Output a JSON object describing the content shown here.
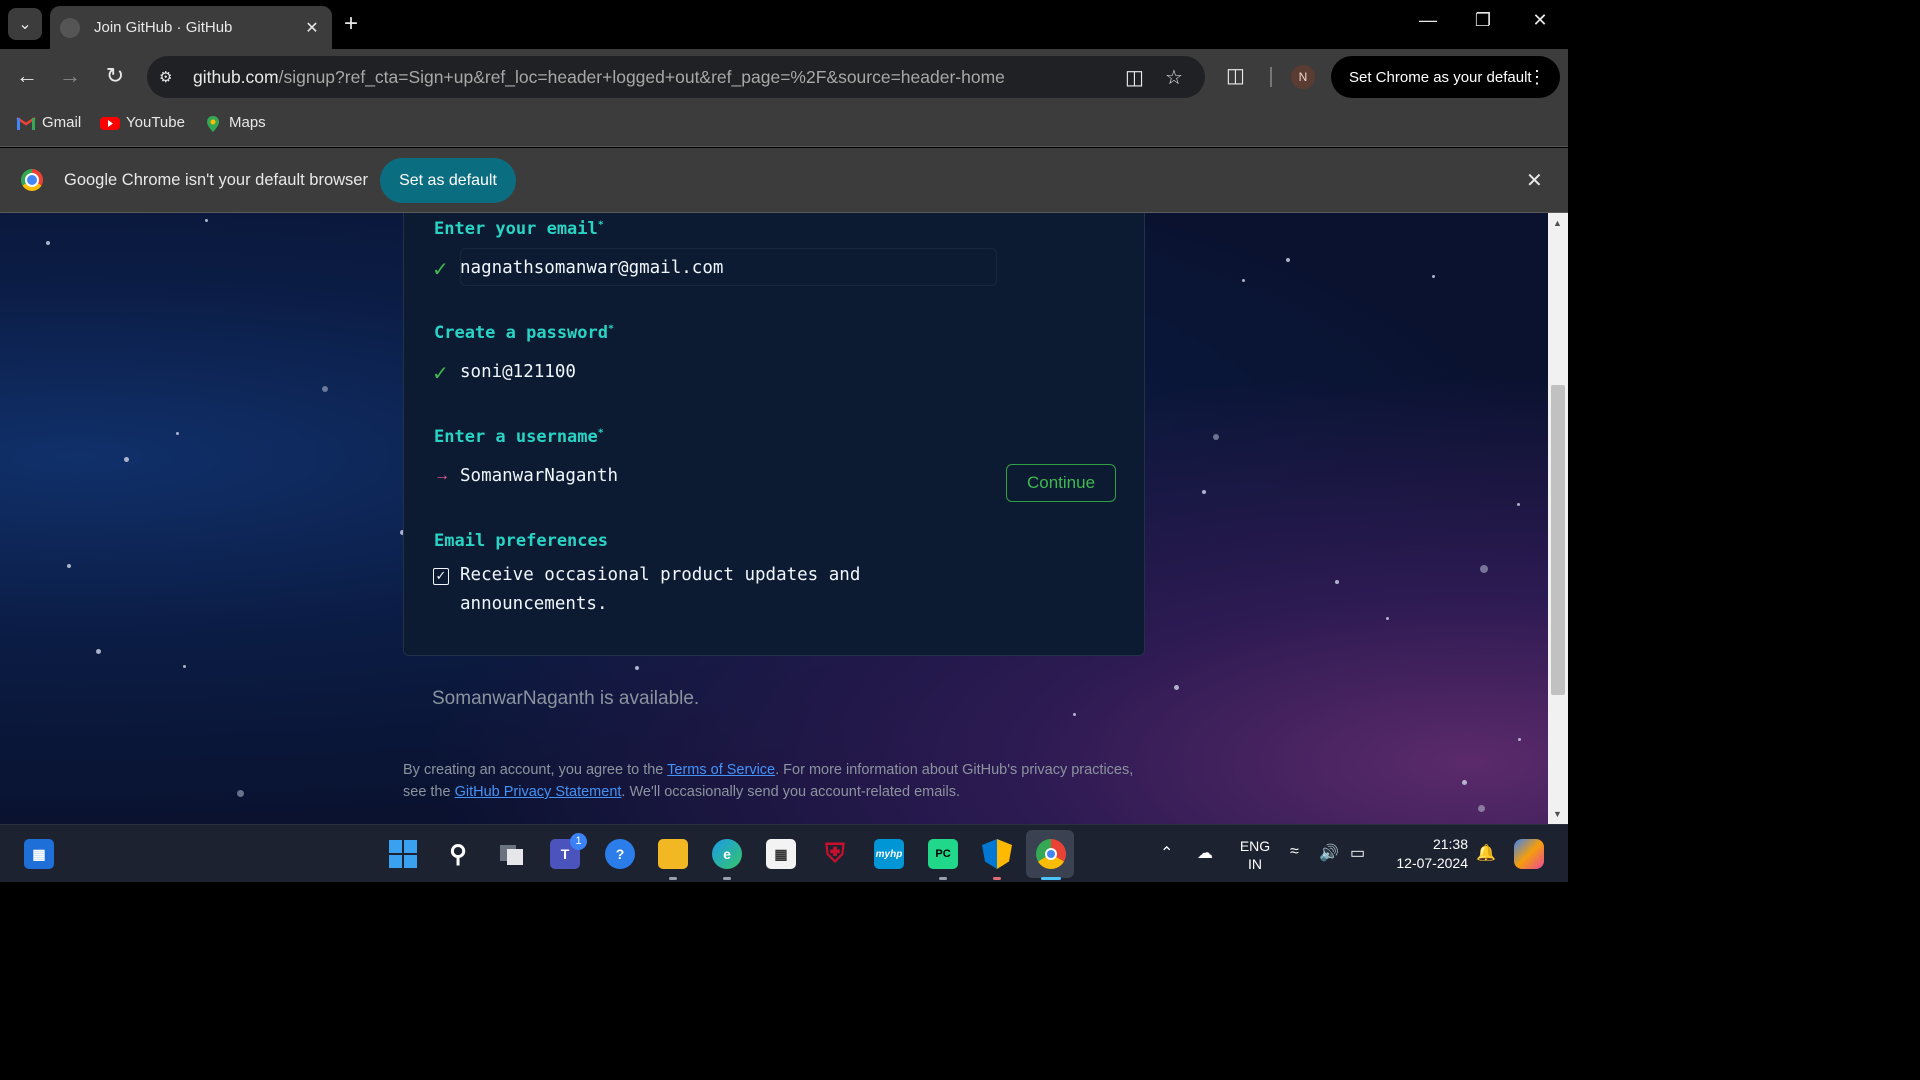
{
  "browser": {
    "tab_title": "Join GitHub · GitHub",
    "url_host": "github.com",
    "url_path": "/signup?ref_cta=Sign+up&ref_loc=header+logged+out&ref_page=%2F&source=header-home",
    "profile_initial": "N",
    "set_default_pill": "Set Chrome as your default",
    "bookmarks": [
      {
        "label": "Gmail",
        "icon": "gmail-icon"
      },
      {
        "label": "YouTube",
        "icon": "youtube-icon"
      },
      {
        "label": "Maps",
        "icon": "maps-icon"
      }
    ],
    "infobar": {
      "message": "Google Chrome isn't your default browser",
      "button": "Set as default"
    }
  },
  "signup": {
    "email_label": "Enter your email",
    "email_value": "nagnathsomanwar@gmail.com",
    "password_label": "Create a password",
    "password_value": "soni@121100",
    "username_label": "Enter a username",
    "username_value": "SomanwarNaganth",
    "continue_button": "Continue",
    "prefs_label": "Email preferences",
    "prefs_checkbox_text": "Receive occasional product updates and announcements.",
    "required_mark": "*",
    "availability": "SomanwarNaganth is available.",
    "legal": {
      "part1": "By creating an account, you agree to the ",
      "tos_link": "Terms of Service",
      "part2": ". For more information about GitHub's privacy practices, see the ",
      "privacy_link": "GitHub Privacy Statement",
      "part3": ". We'll occasionally send you account-related emails."
    }
  },
  "taskbar": {
    "lang_line1": "ENG",
    "lang_line2": "IN",
    "time": "21:38",
    "date": "12-07-2024",
    "teams_badge": "1"
  },
  "colors": {
    "accent_label": "#2ad4c5",
    "success": "#3fb950",
    "link": "#4493f8"
  }
}
